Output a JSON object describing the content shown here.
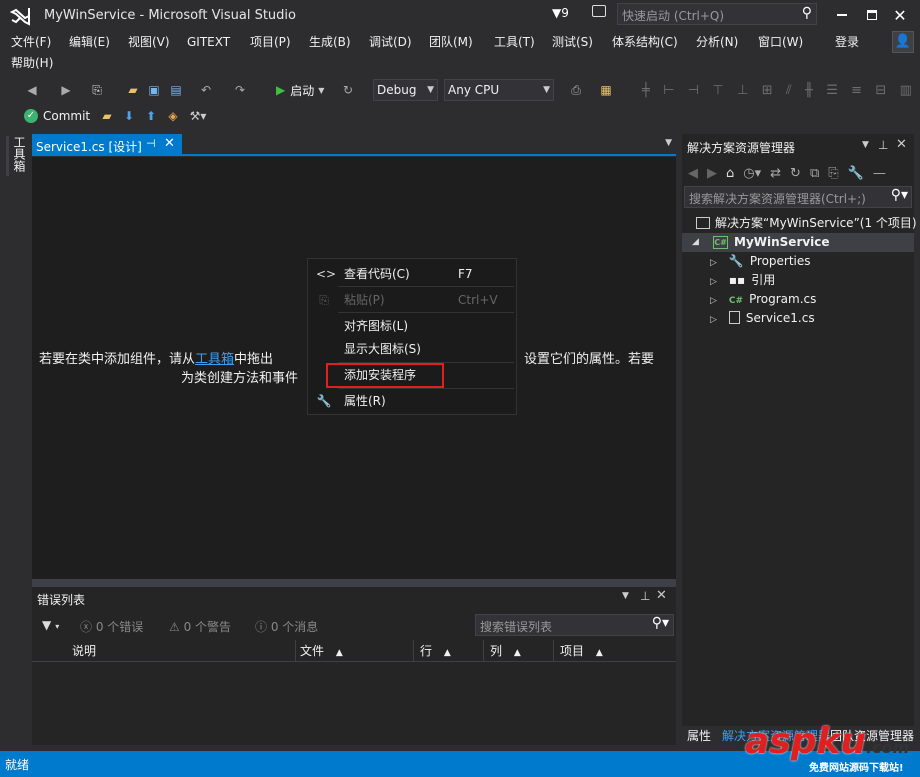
{
  "window": {
    "title": "MyWinService - Microsoft Visual Studio",
    "notifications": "9",
    "quick_launch_placeholder": "快速启动 (Ctrl+Q)"
  },
  "menu": {
    "items": [
      "文件(F)",
      "编辑(E)",
      "视图(V)",
      "GITEXT",
      "项目(P)",
      "生成(B)",
      "调试(D)",
      "团队(M)",
      "工具(T)",
      "测试(S)",
      "体系结构(C)",
      "分析(N)",
      "窗口(W)"
    ],
    "second_row": "帮助(H)",
    "signin": "登录"
  },
  "toolbar": {
    "start": "启动",
    "config": "Debug",
    "platform": "Any CPU",
    "commit": "Commit"
  },
  "toolbox_tab": "工具箱",
  "doc_tab": {
    "label": "Service1.cs [设计]"
  },
  "designer": {
    "line1_a": "若要在类中添加组件，请从",
    "line1_link": "工具箱",
    "line1_b": "中拖出",
    "line1_c": "设置它们的属性。若要",
    "line2_a": "为类创建方法和事件",
    "line2_b": "。"
  },
  "context_menu": {
    "items": [
      {
        "icon": "code-icon",
        "label": "查看代码(C)",
        "shortcut": "F7",
        "disabled": false
      },
      {
        "icon": "paste-icon",
        "label": "粘贴(P)",
        "shortcut": "Ctrl+V",
        "disabled": true
      },
      {
        "icon": "",
        "label": "对齐图标(L)",
        "shortcut": "",
        "disabled": false
      },
      {
        "icon": "",
        "label": "显示大图标(S)",
        "shortcut": "",
        "disabled": false
      },
      {
        "icon": "",
        "label": "添加安装程序",
        "shortcut": "",
        "disabled": false,
        "highlighted": true
      },
      {
        "icon": "wrench-icon",
        "label": "属性(R)",
        "shortcut": "",
        "disabled": false
      }
    ]
  },
  "error_list": {
    "title": "错误列表",
    "errors": "0 个错误",
    "warnings": "0 个警告",
    "messages": "0 个消息",
    "search_placeholder": "搜索错误列表",
    "columns": [
      "说明",
      "文件",
      "行",
      "列",
      "项目"
    ]
  },
  "solution_explorer": {
    "title": "解决方案资源管理器",
    "search_placeholder": "搜索解决方案资源管理器(Ctrl+;)",
    "solution": "解决方案“MyWinService”(1 个项目)",
    "project": "MyWinService",
    "nodes": [
      "Properties",
      "引用",
      "Program.cs",
      "Service1.cs"
    ],
    "tabs": [
      "属性",
      "解决方案资源管理器",
      "团队资源管理器"
    ]
  },
  "status": {
    "text": "就绪"
  },
  "watermark": {
    "brand": "aspku",
    "suffix": ".com",
    "tagline": "免费网站源码下载站!"
  }
}
